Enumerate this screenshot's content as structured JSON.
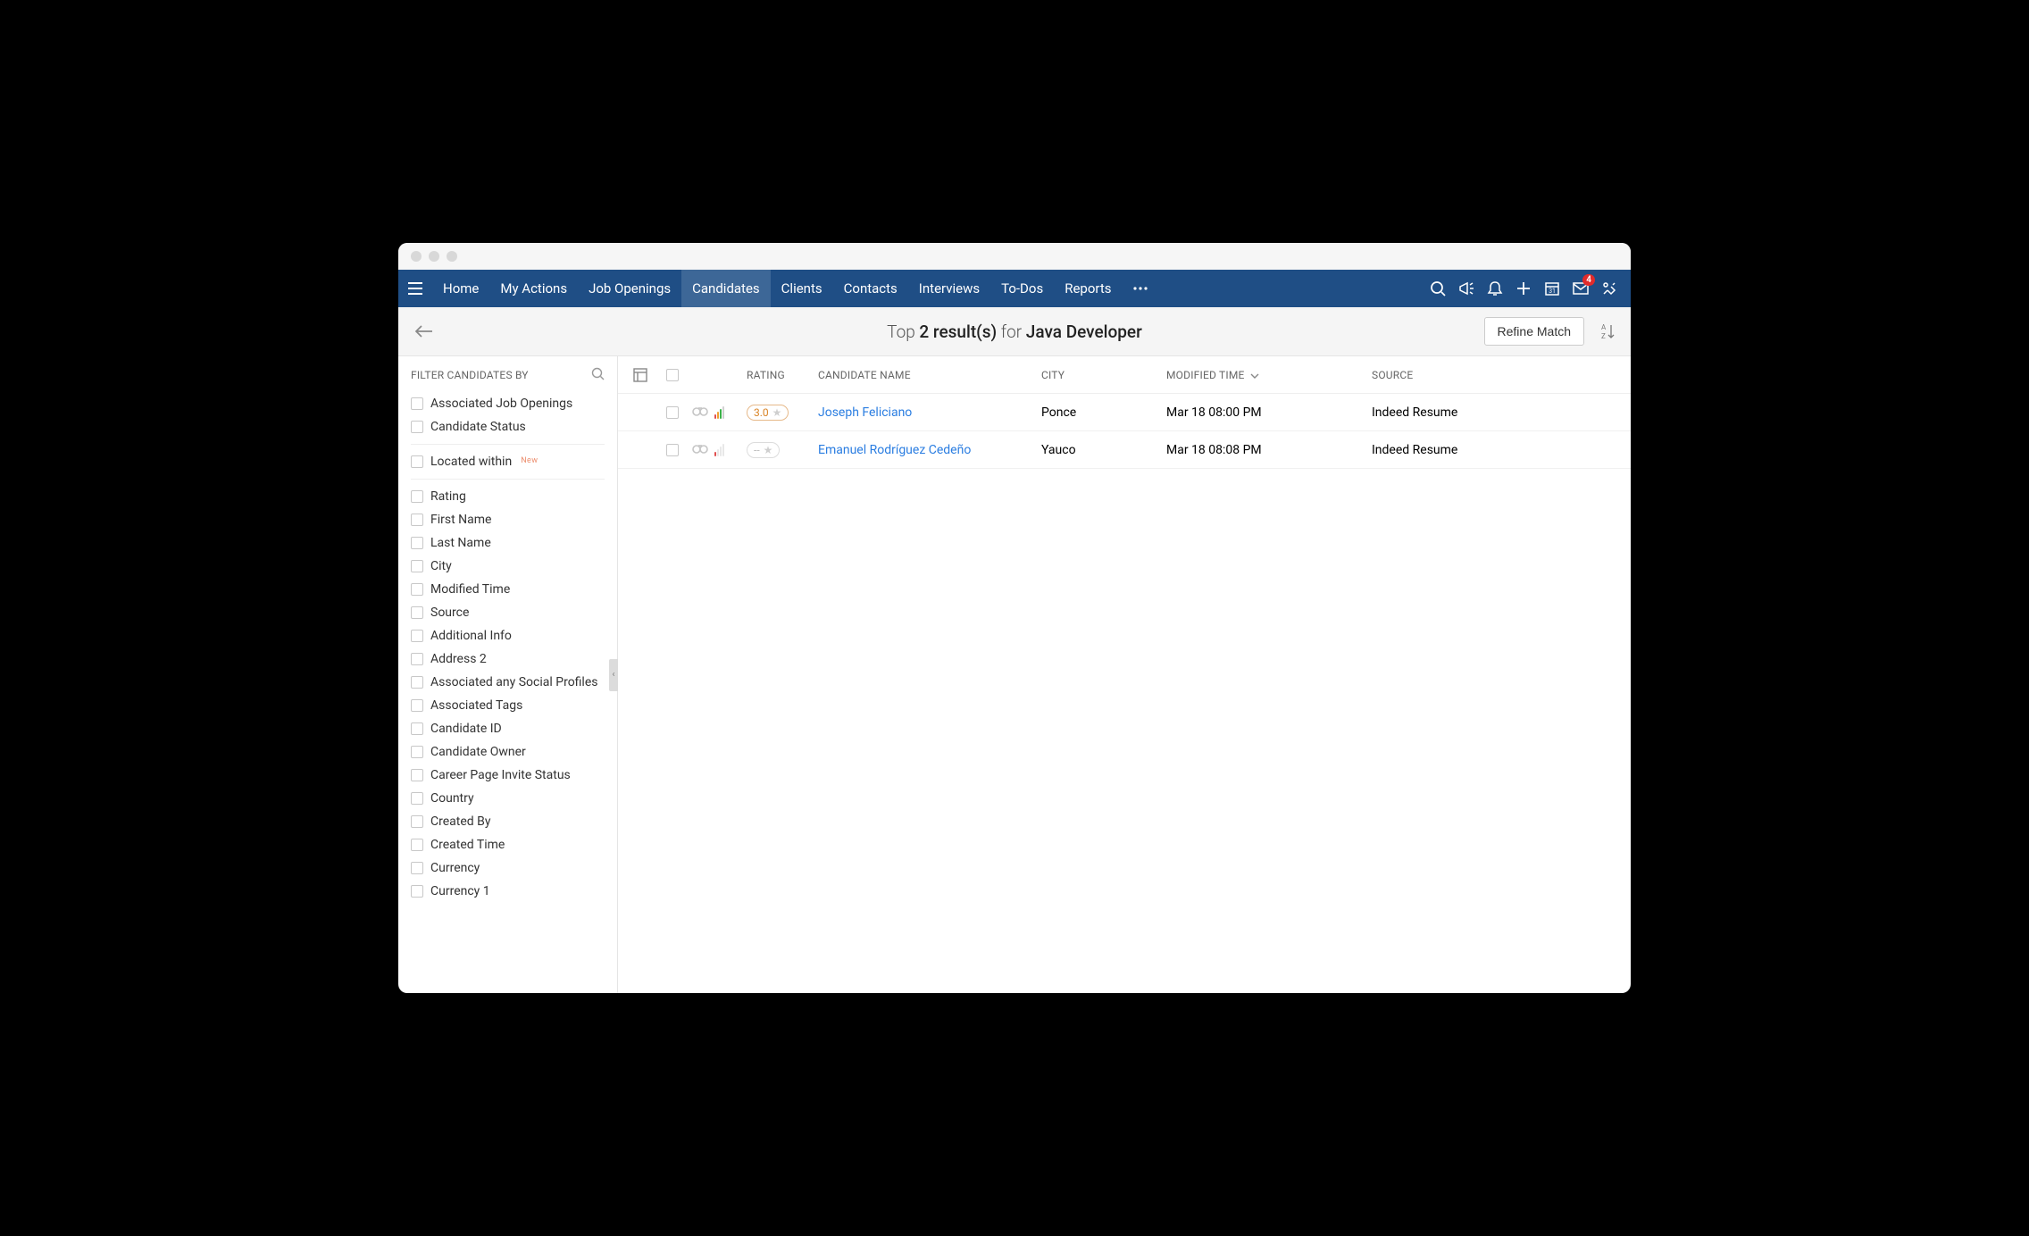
{
  "nav": {
    "items": [
      {
        "label": "Home"
      },
      {
        "label": "My Actions"
      },
      {
        "label": "Job Openings"
      },
      {
        "label": "Candidates",
        "active": true
      },
      {
        "label": "Clients"
      },
      {
        "label": "Contacts"
      },
      {
        "label": "Interviews"
      },
      {
        "label": "To-Dos"
      },
      {
        "label": "Reports"
      }
    ]
  },
  "badge_mail": "4",
  "subhead": {
    "prefix": "Top ",
    "count": "2 result(s)",
    "for": " for ",
    "term": "Java Developer",
    "refine": "Refine Match"
  },
  "sidebar": {
    "title": "FILTER CANDIDATES BY",
    "group1": [
      "Associated Job Openings",
      "Candidate Status"
    ],
    "located": "Located within",
    "located_new": "New",
    "group2": [
      "Rating",
      "First Name",
      "Last Name",
      "City",
      "Modified Time",
      "Source",
      "Additional Info",
      "Address 2",
      "Associated any Social Profiles",
      "Associated Tags",
      "Candidate ID",
      "Candidate Owner",
      "Career Page Invite Status",
      "Country",
      "Created By",
      "Created Time",
      "Currency",
      "Currency 1"
    ]
  },
  "table": {
    "headers": {
      "rating": "RATING",
      "name": "CANDIDATE NAME",
      "city": "CITY",
      "modified": "MODIFIED TIME",
      "source": "SOURCE"
    },
    "rows": [
      {
        "name": "Joseph Feliciano",
        "city": "Ponce",
        "modified": "Mar 18 08:00 PM",
        "source": "Indeed Resume",
        "rating": "3.0",
        "signal": "strong"
      },
      {
        "name": "Emanuel Rodríguez Cedeño",
        "city": "Yauco",
        "modified": "Mar 18 08:08 PM",
        "source": "Indeed Resume",
        "rating": "--",
        "signal": "weak"
      }
    ]
  }
}
